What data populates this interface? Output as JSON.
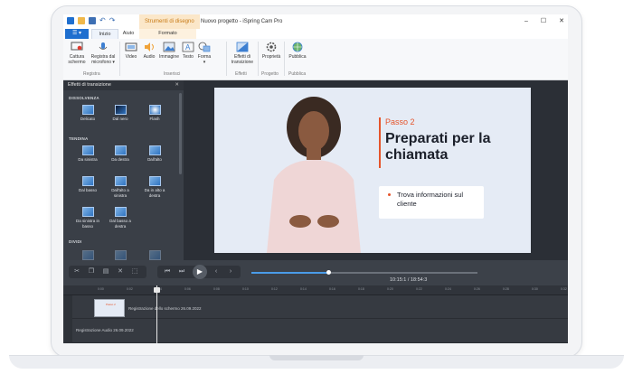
{
  "window": {
    "context_tab": "Strumenti di disegno",
    "title": "Nuovo progetto - iSpring Cam Pro",
    "controls": [
      "–",
      "☐",
      "✕"
    ]
  },
  "ribbon_tabs": {
    "file": "☰ ▾",
    "home": "Inizio",
    "help": "Aiuto",
    "format": "Formato"
  },
  "ribbon": {
    "buttons": [
      {
        "label": "Cattura schermo",
        "icon": "screen-capture-icon"
      },
      {
        "label": "Registra dal microfono ▾",
        "icon": "microphone-icon"
      },
      {
        "label": "Video",
        "icon": "video-icon"
      },
      {
        "label": "Audio",
        "icon": "speaker-icon"
      },
      {
        "label": "Immagine",
        "icon": "image-icon"
      },
      {
        "label": "Testo",
        "icon": "text-icon"
      },
      {
        "label": "Forma ▾",
        "icon": "shape-icon"
      },
      {
        "label": "Effetti di transizione",
        "icon": "transition-icon"
      },
      {
        "label": "Proprietà",
        "icon": "gear-icon"
      },
      {
        "label": "Pubblica",
        "icon": "globe-icon"
      }
    ],
    "groups": [
      "Registra",
      "Inserisci",
      "Effetti",
      "Progetto",
      "Pubblica"
    ]
  },
  "panel": {
    "title": "Effetti di transizione",
    "close": "✕",
    "sections": [
      "DISSOLVENZA",
      "TENDINA",
      "DIVIDI"
    ],
    "dissolve": [
      "Delicato",
      "Dal nero",
      "Flash"
    ],
    "wipe": [
      "Da sinistra",
      "Da destra",
      "Dall'alto",
      "Dal basso",
      "Dall'alto a sinistra",
      "Da in alto a destra",
      "Da sinistra in basso",
      "Dal basso a destra"
    ]
  },
  "slide": {
    "step": "Passo 2",
    "headline": "Preparati per la chiamata",
    "bullet": "Trova informazioni sul cliente"
  },
  "player": {
    "timecode": "10:15:1 / 18:54:3",
    "progress": 0.34
  },
  "timeline": {
    "ticks": [
      "0:00",
      "0:02",
      "0:04",
      "0:06",
      "0:08",
      "0:10",
      "0:12",
      "0:14",
      "0:16",
      "0:18",
      "0:20",
      "0:22",
      "0:24",
      "0:26",
      "0:28",
      "0:30",
      "0:32"
    ],
    "video_track_label": "Registrazione dello schermo 26.09.2022",
    "audio_track_label": "Registrazione Audio 26.09.2022",
    "clip_thumb_text": "Passo 2"
  },
  "colors": {
    "accent": "#e5542b",
    "file_tab": "#1f6fcf",
    "context_tab": "#c87a14"
  }
}
